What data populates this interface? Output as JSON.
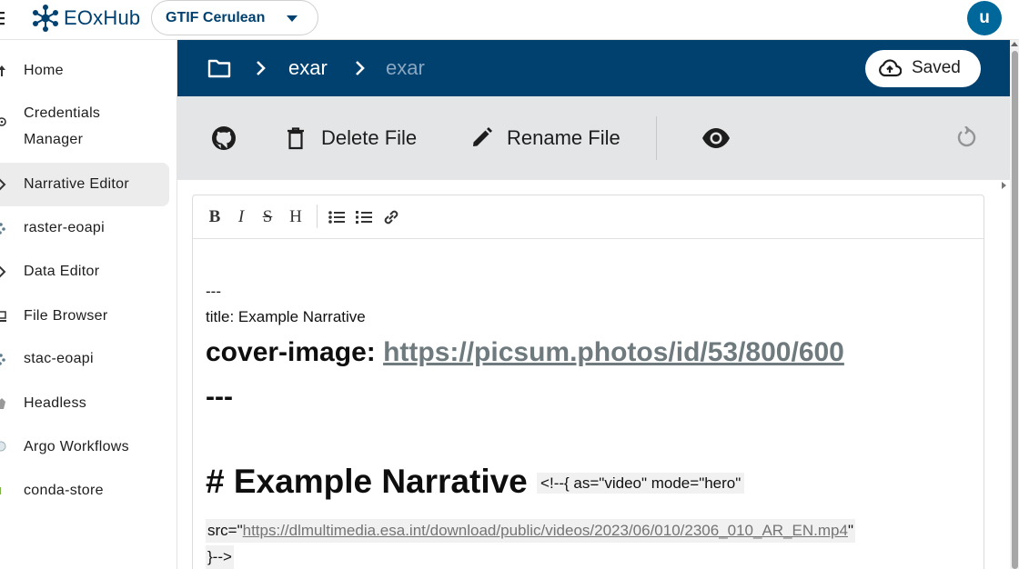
{
  "app": {
    "logo_text": "EOxHub",
    "workspace": "GTIF Cerulean",
    "user_initial": "u"
  },
  "sidebar": {
    "items": [
      {
        "label": "Home",
        "icon": "arrow-up-icon"
      },
      {
        "label": "Credentials",
        "label2": "Manager",
        "icon": "key-icon"
      },
      {
        "label": "Narrative Editor",
        "icon": "narrative-icon",
        "active": true
      },
      {
        "label": "raster-eoapi",
        "icon": "raster-icon"
      },
      {
        "label": "Data Editor",
        "icon": "data-editor-icon"
      },
      {
        "label": "File Browser",
        "icon": "file-browser-icon"
      },
      {
        "label": "stac-eoapi",
        "icon": "stac-icon"
      },
      {
        "label": "Headless",
        "icon": "headless-icon"
      },
      {
        "label": "Argo Workflows",
        "icon": "argo-icon"
      },
      {
        "label": "conda-store",
        "icon": "conda-icon"
      }
    ]
  },
  "header": {
    "breadcrumb": [
      "exar",
      "exar"
    ],
    "saved_label": "Saved"
  },
  "toolbar": {
    "delete_label": "Delete File",
    "rename_label": "Rename File"
  },
  "formatting": {
    "bold": "B",
    "italic": "I",
    "strike": "S",
    "heading": "H"
  },
  "document": {
    "front_matter_open": "---",
    "title_line": "title: Example Narrative",
    "cover_label": "cover-image: ",
    "cover_url": "https://picsum.photos/id/53/800/600",
    "front_matter_close": "---",
    "h1_text": "# Example Narrative",
    "h1_comment": "<!--{ as=\"video\" mode=\"hero\"",
    "src_prefix": "src=\"",
    "src_url": "https://dlmultimedia.esa.int/download/public/videos/2023/06/010/2306_010_AR_EN.mp4",
    "src_suffix": "\"",
    "comment_close": "}-->"
  },
  "colors": {
    "brand": "#004170",
    "toolbar_bg": "#e3e5e7",
    "avatar": "#00679a"
  }
}
